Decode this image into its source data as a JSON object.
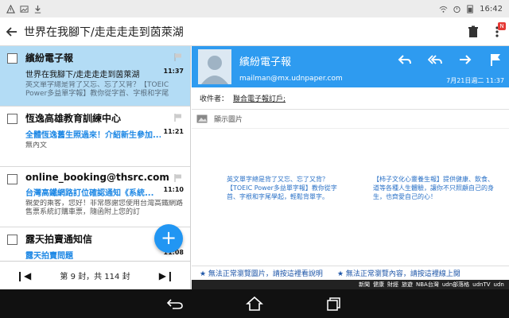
{
  "status_bar": {
    "time": "16:42",
    "icons": [
      "warning-icon",
      "image-icon",
      "download-icon",
      "wifi-icon",
      "alarm-icon",
      "battery-icon"
    ]
  },
  "app_bar": {
    "title": "世界在我腳下/走走走走到茵萊湖"
  },
  "mail_list": [
    {
      "sender": "繽紛電子報",
      "subject": "世界在我腳下/走走走走到茵萊湖",
      "time": "11:37",
      "preview": "英文單字總是背了又忘、忘了又背？【TOEIC Power多益單字報】教你從字首、字根和字尾",
      "selected": true,
      "subject_highlight": false
    },
    {
      "sender": "恆逸高雄教育訓練中心",
      "subject": "全體恆逸舊生照過來！介紹新生參加...",
      "time": "11:21",
      "preview": "無內文",
      "selected": false,
      "subject_highlight": true
    },
    {
      "sender": "online_booking@thsrc.com.tw",
      "subject": "台灣高鐵網路訂位確認通知《系統...",
      "time": "11:10",
      "preview": "親愛的乘客，您好！非常感謝您使用台灣高鐵網路售票系統訂購車票，隨函附上您的訂",
      "selected": false,
      "subject_highlight": true
    },
    {
      "sender": "露天拍賣通知信",
      "subject": "露天拍賣問題",
      "time": "11:08",
      "preview": "",
      "selected": false,
      "subject_highlight": true
    }
  ],
  "pager": {
    "text": "第 9 封，共 114 封",
    "prev_label": "❙◀",
    "next_label": "▶❙"
  },
  "fab": {
    "label": "+"
  },
  "reading": {
    "sender": "繽紛電子報",
    "email": "mailman@mx.udnpaper.com",
    "date": "7月21日週二 11:37",
    "to_label": "收件者：",
    "to_value": "聯合電子報訂戶;",
    "show_images": "顯示圖片",
    "body_col1": "英文單字總是背了又忘、忘了又背？【TOEIC Power多益單字報】教你從字首、字根和字尾學起，輕鬆背單字。",
    "body_col2_line1": "【柿子文化心靈養生報】提供健康、飲食、",
    "body_col2_line2": "道等各種人生體驗，讓你不只照顧自己的身",
    "body_col2_line3": "生，也齊愛自己的心！",
    "notice1": "★ 無法正常瀏覽圖片，請按這裡看說明",
    "notice2": "★ 無法正常瀏覽內容，請按這裡線上閱",
    "nav_items": [
      "新聞",
      "健康",
      "財經",
      "旅遊",
      "NBA台灣",
      "udn部落格",
      "udnTV",
      "udn"
    ]
  },
  "colors": {
    "accent": "#2e9bf0",
    "selected_bg": "#b3dcf5",
    "fab": "#2196f3",
    "link": "#1e88e5"
  }
}
